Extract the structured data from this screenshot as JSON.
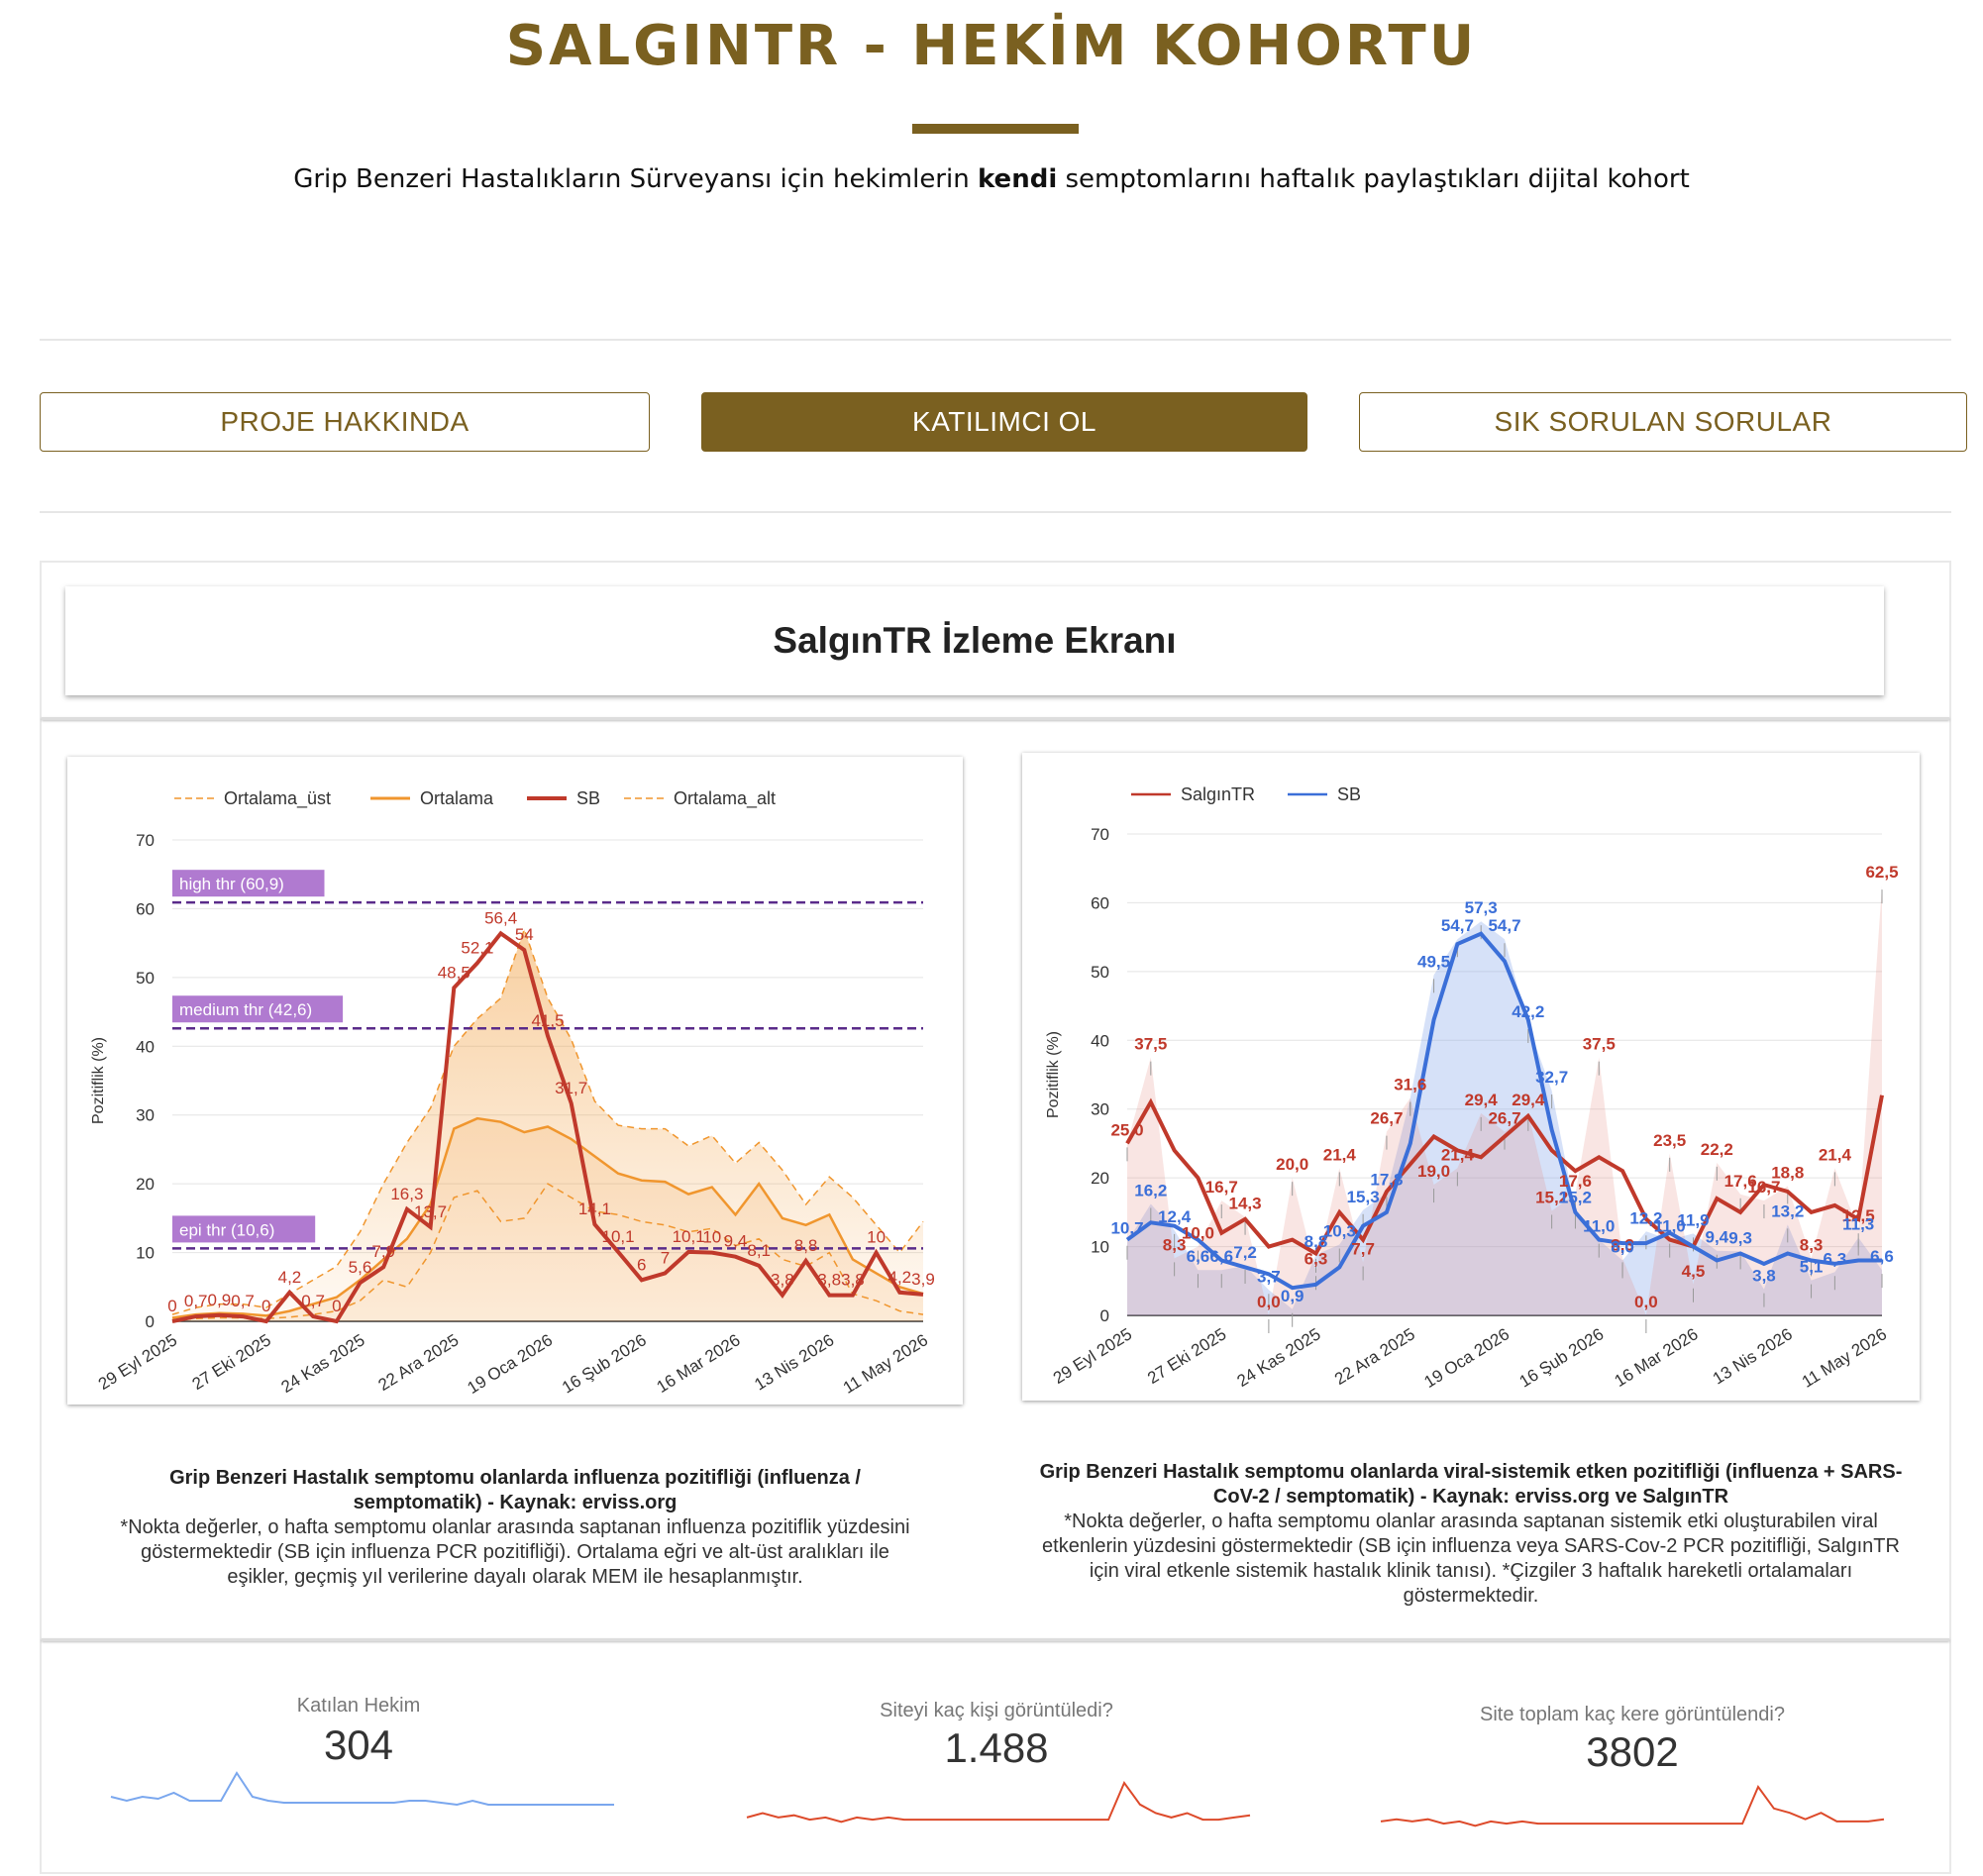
{
  "header": {
    "title": "SALGINTR - HEKİM KOHORTU",
    "subtitle_pre": "Grip Benzeri Hastalıkların Sürveyansı için hekimlerin ",
    "subtitle_bold": "kendi",
    "subtitle_post": " semptomlarını haftalık paylaştıkları dijital kohort"
  },
  "nav": {
    "about": "PROJE HAKKINDA",
    "join": "KATILIMCI OL",
    "faq": "SIK SORULAN SORULAR"
  },
  "dashboard": {
    "title": "SalgınTR İzleme Ekranı"
  },
  "chart_data": [
    {
      "type": "line",
      "legend": [
        "Ortalama_üst",
        "Ortalama",
        "SB",
        "Ortalama_alt"
      ],
      "legend_position": "top-left",
      "ylabel": "Pozitiflik (%)",
      "ylim": [
        0,
        70
      ],
      "yticks": [
        0,
        10,
        20,
        30,
        40,
        50,
        60,
        70
      ],
      "xticks": [
        "29 Eyl 2025",
        "27 Eki 2025",
        "24 Kas 2025",
        "22 Ara 2025",
        "19 Oca 2026",
        "16 Şub 2026",
        "16 Mar 2026",
        "13 Nis 2026",
        "11 May 2026"
      ],
      "thresholds": [
        {
          "label": "high thr (60,9)",
          "value": 60.9
        },
        {
          "label": "medium thr (42,6)",
          "value": 42.6
        },
        {
          "label": "epi thr (10,6)",
          "value": 10.6
        }
      ],
      "series": [
        {
          "name": "SB",
          "color": "#c0392b",
          "values": [
            0,
            0.7,
            0.9,
            0.7,
            0,
            4.2,
            0.7,
            0,
            5.6,
            7.9,
            16.3,
            13.7,
            48.5,
            52.1,
            56.4,
            54,
            41.5,
            31.7,
            14.1,
            10.1,
            6,
            7,
            10.1,
            10,
            9.4,
            8.1,
            3.8,
            8.8,
            3.8,
            3.8,
            10,
            4.2,
            3.9
          ]
        },
        {
          "name": "Ortalama",
          "color": "#f0962e",
          "values": [
            0.5,
            1,
            1.2,
            1.1,
            0.8,
            1.5,
            2.5,
            3.5,
            6,
            9,
            12,
            17,
            28,
            29.5,
            29,
            27.5,
            28.3,
            26.5,
            24,
            21.5,
            20.5,
            20.3,
            18.5,
            19.5,
            15.5,
            20,
            15,
            14,
            15.5,
            9,
            7,
            5,
            4
          ]
        },
        {
          "name": "Ortalama_üst",
          "color": "#f0962e",
          "values": [
            1,
            2,
            2.5,
            2.5,
            2,
            4,
            6,
            8,
            13,
            20,
            26,
            31,
            40,
            44,
            47,
            57,
            47,
            41,
            32,
            28.5,
            28,
            28,
            25.5,
            27,
            23,
            26,
            22,
            17,
            21,
            18,
            14,
            10,
            14.5
          ]
        },
        {
          "name": "Ortalama_alt",
          "color": "#f0962e",
          "values": [
            0.2,
            0.4,
            0.5,
            0.5,
            0.4,
            0.6,
            1,
            1.5,
            3,
            6,
            5,
            10,
            18,
            19,
            14.5,
            15,
            20,
            18,
            16,
            15.5,
            14.5,
            14,
            13,
            13.5,
            11,
            12,
            9,
            8,
            10,
            4,
            3,
            1.5,
            1
          ]
        }
      ],
      "point_labels": [
        "0",
        "0,7",
        "0,9",
        "0,7",
        "0",
        "4,2",
        "0,7",
        "0",
        "5,6",
        "7,9",
        "16,3",
        "13,7",
        "48,5",
        "52,1",
        "56,4",
        "54",
        "41,5",
        "31,7",
        "14,1",
        "10,1",
        "6",
        "7",
        "10,1",
        "10",
        "9,4",
        "8,1",
        "3,8",
        "8,8",
        "3,8",
        "3,8",
        "10",
        "4,2",
        "3,9"
      ],
      "caption_title": "Grip Benzeri Hastalık semptomu olanlarda influenza pozitifliği (influenza / semptomatik) - Kaynak: erviss.org",
      "caption_note": "*Nokta değerler, o hafta semptomu olanlar arasında saptanan influenza pozitiflik yüzdesini göstermektedir (SB için influenza PCR pozitifliği). Ortalama eğri ve alt-üst aralıkları ile eşikler, geçmiş yıl verilerine dayalı olarak MEM ile hesaplanmıştır."
    },
    {
      "type": "line",
      "legend": [
        "SalgınTR",
        "SB"
      ],
      "legend_position": "top-left",
      "ylabel": "Pozitiflik (%)",
      "ylim": [
        0,
        70
      ],
      "yticks": [
        0,
        10,
        20,
        30,
        40,
        50,
        60,
        70
      ],
      "xticks": [
        "29 Eyl 2025",
        "27 Eki 2025",
        "24 Kas 2025",
        "22 Ara 2025",
        "19 Oca 2026",
        "16 Şub 2026",
        "16 Mar 2026",
        "13 Nis 2026",
        "11 May 2026"
      ],
      "series": [
        {
          "name": "SalgınTR",
          "color": "#c0392b",
          "raw": [
            25.0,
            37.5,
            8.3,
            10.0,
            16.7,
            14.3,
            0.0,
            20.0,
            6.3,
            21.4,
            7.7,
            26.7,
            31.6,
            19.0,
            21.4,
            29.4,
            26.7,
            29.4,
            15.2,
            17.6,
            37.5,
            8.3,
            0.0,
            23.5,
            4.5,
            22.2,
            17.6,
            16.7,
            18.8,
            8.3,
            21.4,
            12.5,
            62.5
          ],
          "values": [
            25,
            31,
            24,
            20,
            12,
            14,
            10,
            11,
            9,
            15,
            11,
            18,
            22,
            26,
            24,
            23,
            26,
            29,
            24,
            21,
            23,
            21,
            14,
            11,
            10,
            17,
            15,
            19,
            18,
            15,
            16,
            14,
            32
          ]
        },
        {
          "name": "SB",
          "color": "#3b6fd8",
          "raw": [
            10.7,
            16.2,
            12.4,
            6.6,
            6.6,
            7.2,
            3.7,
            0.9,
            8.8,
            10.3,
            15.3,
            17.8,
            31.6,
            49.5,
            54.7,
            57.3,
            54.7,
            42.2,
            32.7,
            15.2,
            11.0,
            8.0,
            12.2,
            11.0,
            11.9,
            9.4,
            9.3,
            3.8,
            13.2,
            5.1,
            6.3,
            11.3,
            6.6
          ],
          "values": [
            11,
            13.5,
            13,
            11,
            8,
            7,
            6,
            4,
            4.5,
            7,
            13,
            15,
            25,
            43,
            54,
            55.5,
            51.5,
            43,
            27,
            15,
            11,
            10.5,
            10.5,
            12,
            10,
            8,
            9,
            7.5,
            9,
            8,
            7.5,
            8,
            8
          ]
        }
      ],
      "point_labels": {
        "SalgınTR": [
          "25,0",
          "37,5",
          "8,3",
          "10,0",
          "16,7",
          "14,3",
          "0,0",
          "20,0",
          "6,3",
          "21,4",
          "7,7",
          "26,7",
          "31,6",
          "19,0",
          "21,4",
          "29,4",
          "26,7",
          "29,4",
          "15,2",
          "17,6",
          "37,5",
          "8,3",
          "0,0",
          "23,5",
          "4,5",
          "22,2",
          "17,6",
          "16,7",
          "18,8",
          "8,3",
          "21,4",
          "12,5",
          "62,5"
        ],
        "SB": [
          "10,7",
          "16,2",
          "12,4",
          "6,6",
          "6,6",
          "7,2",
          "3,7",
          "0,9",
          "8,8",
          "10,3",
          "15,3",
          "17,8",
          "",
          "49,5",
          "54,7",
          "57,3",
          "54,7",
          "42,2",
          "32,7",
          "15,2",
          "11,0",
          "8,0",
          "12,2",
          "11,0",
          "11,9",
          "9,4",
          "9,3",
          "3,8",
          "13,2",
          "5,1",
          "6,3",
          "11,3",
          "6,6"
        ]
      },
      "caption_title": "Grip Benzeri Hastalık semptomu olanlarda viral-sistemik etken pozitifliği (influenza + SARS-CoV-2 / semptomatik) - Kaynak: erviss.org ve SalgınTR",
      "caption_note": "*Nokta değerler, o hafta semptomu olanlar arasında saptanan sistemik etki oluşturabilen viral etkenlerin yüzdesini göstermektedir (SB için influenza veya SARS-Cov-2 PCR pozitifliği, SalgınTR için viral etkenle sistemik hastalık klinik tanısı). *Çizgiler 3 haftalık hareketli ortalamaları göstermektedir."
    },
    {
      "type": "line",
      "title": "Katılan Hekim",
      "value": "304",
      "color": "#7aa7ee",
      "values": [
        6,
        5,
        6,
        5.5,
        7,
        5,
        5,
        5,
        12,
        6,
        5,
        4.5,
        4.5,
        4.5,
        4.5,
        4.5,
        4.5,
        4.5,
        4.5,
        5,
        5,
        4.5,
        4,
        5,
        4,
        4,
        4,
        4,
        4,
        4,
        4,
        4,
        4
      ]
    },
    {
      "type": "line",
      "title": "Siteyi kaç kişi görüntüledi?",
      "value": "1.488",
      "color": "#dd4a2a",
      "values": [
        3,
        4,
        3,
        3.5,
        2.5,
        3,
        2,
        3,
        2.5,
        3,
        2.5,
        2.5,
        2.5,
        2.5,
        2.5,
        2.5,
        2.5,
        2.5,
        2.5,
        2.5,
        2.5,
        2.5,
        2.5,
        2.5,
        11,
        6,
        4,
        3,
        4,
        2.5,
        2.5,
        3,
        3.5
      ]
    },
    {
      "type": "line",
      "title": "Site toplam kaç kere görüntülendi?",
      "value": "3802",
      "color": "#dd4a2a",
      "values": [
        3,
        3.5,
        3,
        3.5,
        2.5,
        3,
        2,
        3,
        2.5,
        3,
        2.5,
        2.5,
        2.5,
        2.5,
        2.5,
        2.5,
        2.5,
        2.5,
        2.5,
        2.5,
        2.5,
        2.5,
        2.5,
        2.5,
        11,
        6,
        5,
        3.5,
        5,
        3,
        3,
        3,
        3.5
      ]
    }
  ]
}
